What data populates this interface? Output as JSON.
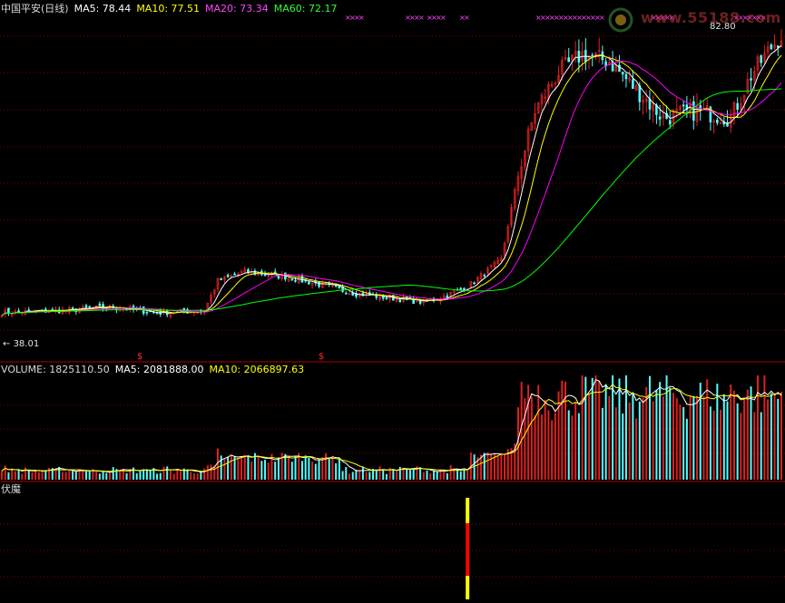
{
  "price_header": {
    "name": "中国平安(日线)",
    "ma5": "MA5: 78.44",
    "ma10": "MA10: 77.51",
    "ma20": "MA20: 73.34",
    "ma60": "MA60: 72.17"
  },
  "volume_header": {
    "volume": "VOLUME: 1825110.50",
    "ma5": "MA5: 2081888.00",
    "ma10": "MA10: 2066897.63"
  },
  "indicator_header": {
    "name": "伏魔"
  },
  "labels": {
    "high": "82.80",
    "low": "38.01"
  },
  "watermark": {
    "text": "www.55188.com"
  },
  "colors": {
    "background": "#000000",
    "up": "#e02020",
    "down": "#54ffff",
    "ma5": "#ffffff",
    "ma10": "#ffff00",
    "ma20": "#ff00ff",
    "ma60": "#00ff00",
    "grid": "#7a0000",
    "signal_top": "#ffff00",
    "signal_mid": "#ff0000",
    "signal_bottom": "#ffff00"
  },
  "chart_data": {
    "type": "line",
    "ylim": [
      38.01,
      82.8
    ],
    "n_bars": 232,
    "close_anchors": [
      [
        0,
        42.5
      ],
      [
        20,
        42.9
      ],
      [
        33,
        43.3
      ],
      [
        46,
        42.5
      ],
      [
        60,
        42.8
      ],
      [
        64,
        47
      ],
      [
        72,
        48.3
      ],
      [
        85,
        47.5
      ],
      [
        95,
        46.4
      ],
      [
        105,
        45.2
      ],
      [
        112,
        44.8
      ],
      [
        125,
        44.0
      ],
      [
        132,
        45.0
      ],
      [
        138,
        46.2
      ],
      [
        148,
        50
      ],
      [
        153,
        62
      ],
      [
        158,
        71
      ],
      [
        165,
        76.5
      ],
      [
        172,
        79
      ],
      [
        180,
        78
      ],
      [
        190,
        73
      ],
      [
        196,
        70
      ],
      [
        206,
        71
      ],
      [
        216,
        70
      ],
      [
        222,
        76
      ],
      [
        228,
        80
      ],
      [
        231,
        81.6
      ]
    ],
    "series": [
      {
        "name": "MA5",
        "value": 78.44
      },
      {
        "name": "MA10",
        "value": 77.51
      },
      {
        "name": "MA20",
        "value": 73.34
      },
      {
        "name": "MA60",
        "value": 72.17
      }
    ],
    "volume": {
      "last": 1825110.5,
      "ma5": 2081888.0,
      "ma10": 2066897.63
    },
    "signal_bar_index": 138
  }
}
